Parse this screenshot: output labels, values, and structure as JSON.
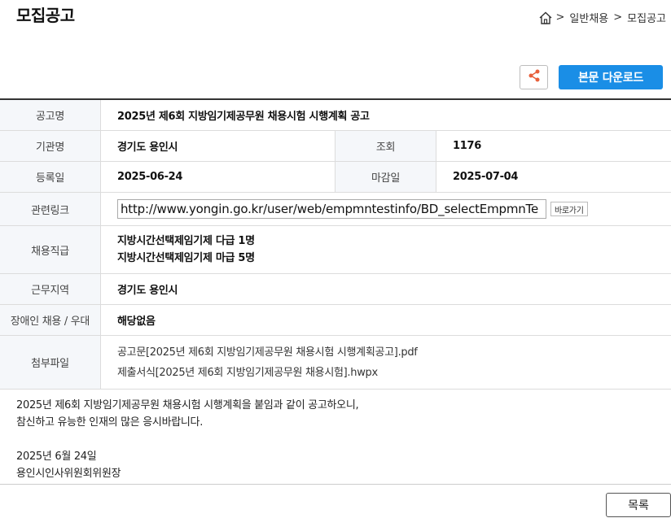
{
  "header": {
    "title": "모집공고",
    "breadcrumb": [
      ">",
      "일반채용",
      ">",
      "모집공고"
    ]
  },
  "actions": {
    "share_icon": "share-icon",
    "download_label": "본문 다운로드"
  },
  "details": {
    "title_label": "공고명",
    "title_value": "2025년 제6회 지방임기제공무원 채용시험 시행계획 공고",
    "agency_label": "기관명",
    "agency_value": "경기도 용인시",
    "views_label": "조회",
    "views_value": "1176",
    "posted_label": "등록일",
    "posted_value": "2025-06-24",
    "deadline_label": "마감일",
    "deadline_value": "2025-07-04",
    "link_label": "관련링크",
    "link_value": "http://www.yongin.go.kr/user/web/empmntestinfo/BD_selectEmpmnTe",
    "goto_label": "바로가기",
    "position_label": "채용직급",
    "positions": [
      "지방시간선택제임기제 다급 1명",
      "지방시간선택제임기제 마급 5명"
    ],
    "location_label": "근무지역",
    "location_value": "경기도 용인시",
    "disabled_label": "장애인 채용 / 우대",
    "disabled_value": "해당없음",
    "files_label": "첨부파일",
    "files": [
      "공고문[2025년 제6회 지방임기제공무원 채용시험 시행계획공고].pdf",
      "제출서식[2025년 제6회 지방임기제공무원 채용시험].hwpx"
    ]
  },
  "body": {
    "line1": "2025년 제6회 지방임기제공무원 채용시험 시행계획을 붙임과 같이 공고하오니,",
    "line2": "참신하고 유능한 인재의 많은 응시바랍니다.",
    "date": "2025년 6월 24일",
    "signer": "용인시인사위원회위원장"
  },
  "footer": {
    "list_label": "목록"
  }
}
